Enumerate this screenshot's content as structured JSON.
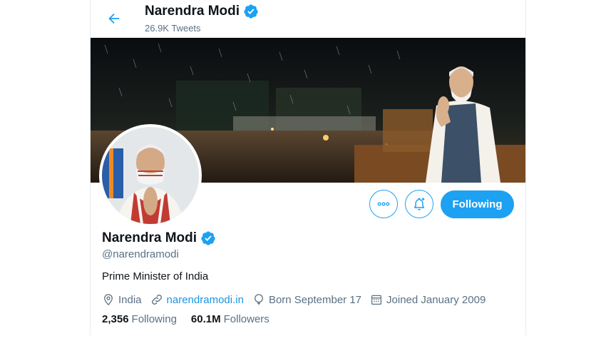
{
  "header": {
    "name": "Narendra Modi",
    "tweet_count": "26.9K Tweets"
  },
  "profile": {
    "display_name": "Narendra Modi",
    "handle": "@narendramodi",
    "bio": "Prime Minister of India",
    "location": "India",
    "website": "narendramodi.in",
    "birthday": "Born September 17",
    "joined": "Joined January 2009"
  },
  "stats": {
    "following_count": "2,356",
    "following_label": "Following",
    "followers_count": "60.1M",
    "followers_label": "Followers"
  },
  "actions": {
    "follow_button_label": "Following"
  },
  "colors": {
    "accent": "#1da1f2",
    "link": "#1b95e0",
    "secondary_text": "#5b7083",
    "verified": "#1da1f2"
  },
  "icons": [
    "back-arrow-icon",
    "verified-badge-icon",
    "more-icon",
    "notification-bell-icon",
    "location-pin-icon",
    "link-icon",
    "birthday-balloon-icon",
    "calendar-icon"
  ]
}
